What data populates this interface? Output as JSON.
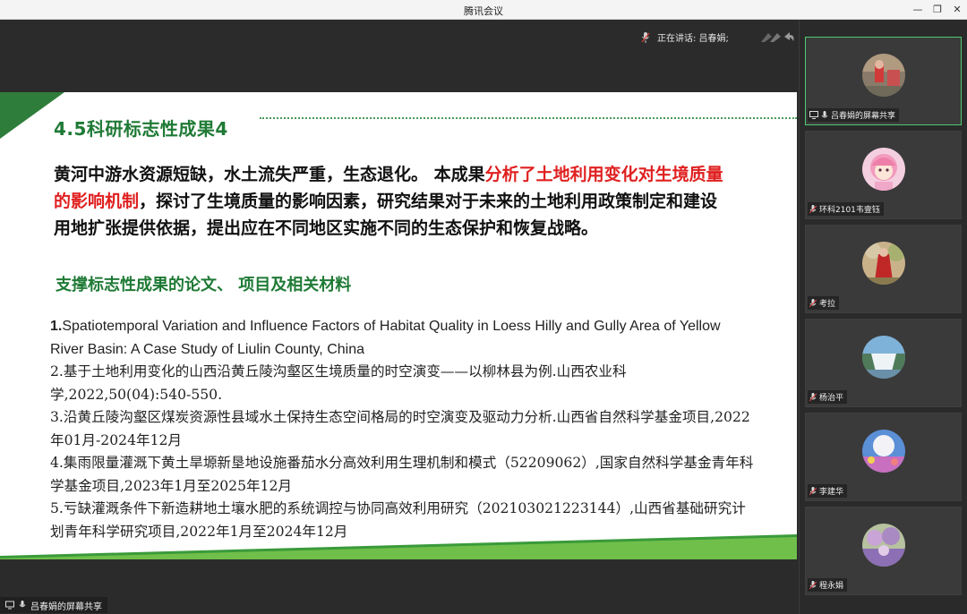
{
  "window": {
    "title": "腾讯会议",
    "minimize": "—",
    "restore": "❐",
    "close": "✕"
  },
  "header": {
    "speaking_label": "正在讲话: 吕春娟;"
  },
  "slide": {
    "heading": "4.5科研标志性成果4",
    "para_a": "黄河中游水资源短缺，水土流失严重，生态退化。 本成果",
    "para_red": "分析了土地利用变化对生境质量的影响机制",
    "para_b": "，探讨了生境质量的影响因素，研究结果对于未来的土地利用政策制定和建设用地扩张提供依据，提出应在不同地区实施不同的生态保护和恢复战略。",
    "subheading": "支撑标志性成果的论文、 项目及相关材料",
    "ref1_num": "1.",
    "ref1_text": "Spatiotemporal Variation and Influence Factors of Habitat Quality in Loess Hilly and Gully Area of Yellow River Basin: A Case Study of Liulin County, China",
    "ref2": "2.基于土地利用变化的山西沿黄丘陵沟壑区生境质量的时空演变——以柳林县为例.山西农业科学,2022,50(04):540-550.",
    "ref3": "3.沿黄丘陵沟壑区煤炭资源性县域水土保持生态空间格局的时空演变及驱动力分析.山西省自然科学基金项目,2022年01月-2024年12月",
    "ref4": "4.集雨限量灌溉下黄土旱塬新垦地设施番茄水分高效利用生理机制和模式（52209062）,国家自然科学基金青年科学基金项目,2023年1月至2025年12月",
    "ref5": "5.亏缺灌溉条件下新造耕地土壤水肥的系统调控与协同高效利用研究（202103021223144）,山西省基础研究计划青年科学研究项目,2022年1月至2024年12月"
  },
  "share_bar": {
    "label": "吕春娟的屏幕共享"
  },
  "participants": [
    {
      "name": "吕春娟的屏幕共享",
      "icon": "screen-share-icon",
      "active": true
    },
    {
      "name": "环科2101韦壹钰",
      "icon": "mic-muted-icon",
      "active": false
    },
    {
      "name": "考拉",
      "icon": "mic-muted-icon",
      "active": false
    },
    {
      "name": "杨治平",
      "icon": "mic-muted-icon",
      "active": false
    },
    {
      "name": "李建华",
      "icon": "mic-muted-icon",
      "active": false
    },
    {
      "name": "程永娟",
      "icon": "mic-muted-icon",
      "active": false
    }
  ],
  "colors": {
    "accent_green": "#1f7a35",
    "highlight_red": "#e02020",
    "active_border": "#4ecb71"
  }
}
